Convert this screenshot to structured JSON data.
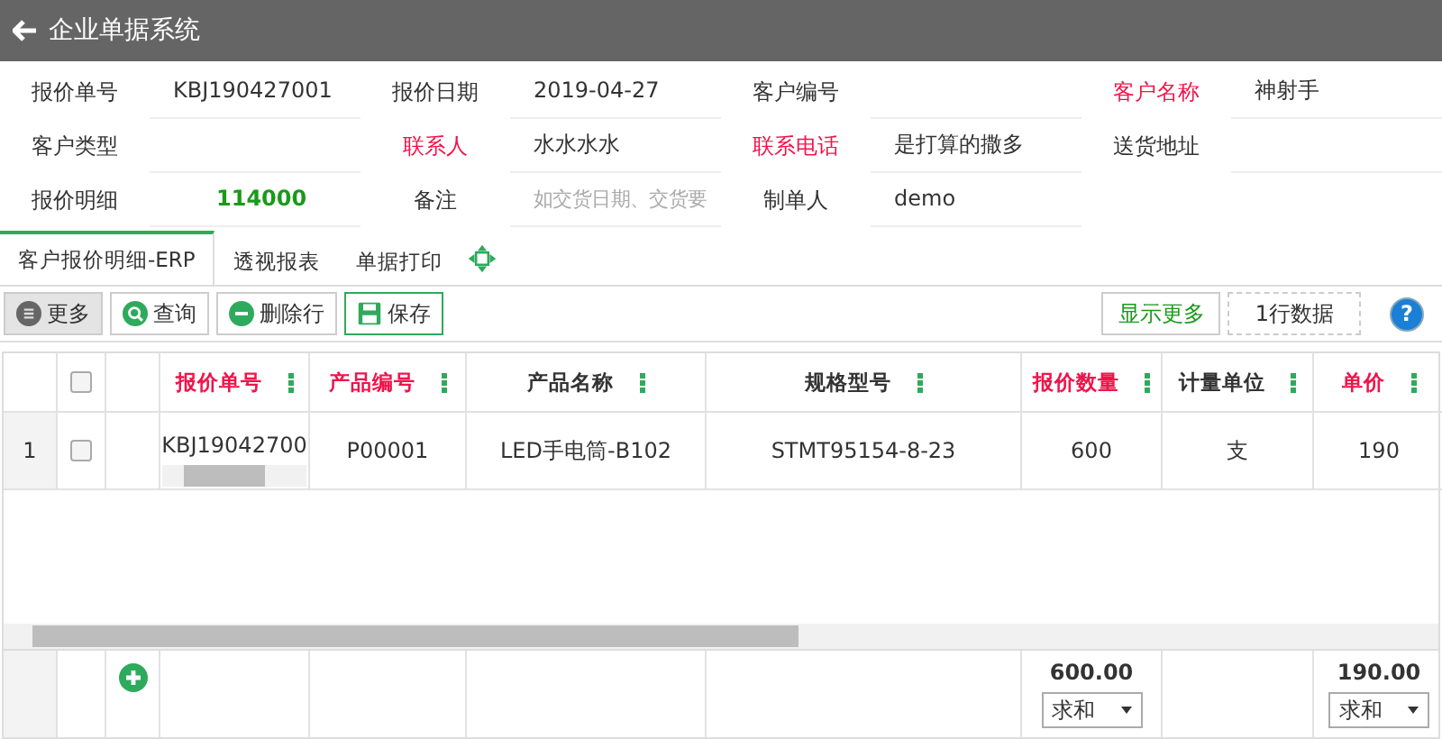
{
  "window": {
    "title": "企业单据系统"
  },
  "form": [
    {
      "label": "报价单号",
      "required": false,
      "kind": "text",
      "value": "KBJ190427001"
    },
    {
      "label": "报价日期",
      "required": false,
      "kind": "text",
      "value": "2019-04-27"
    },
    {
      "label": "客户编号",
      "required": false,
      "kind": "text"
    },
    {
      "label": "客户名称",
      "required": true,
      "kind": "text",
      "value": "神射手"
    },
    {
      "label": "客户类型",
      "required": false,
      "kind": "text"
    },
    {
      "label": "联系人",
      "required": true,
      "kind": "text",
      "value": "水水水水"
    },
    {
      "label": "联系电话",
      "required": true,
      "kind": "text",
      "value": "是打算的撒多"
    },
    {
      "label": "送货地址",
      "required": false,
      "kind": "text"
    },
    {
      "label": "报价明细",
      "required": false,
      "kind": "amount",
      "value": "114000"
    },
    {
      "label": "备注",
      "required": false,
      "kind": "text",
      "placeholder": "如交货日期、交货要"
    },
    {
      "label": "制单人",
      "required": false,
      "kind": "text",
      "value": "demo"
    }
  ],
  "tabs": [
    {
      "label": "客户报价明细-ERP",
      "selected": true
    },
    {
      "label": "透视报表",
      "selected": false
    },
    {
      "label": "单据打印",
      "selected": false
    }
  ],
  "toolbar": [
    {
      "label": "更多",
      "kind": "more"
    },
    {
      "label": "查询",
      "kind": "search"
    },
    {
      "label": "删除行",
      "kind": "delete"
    },
    {
      "label": "保存",
      "kind": "save"
    }
  ],
  "toolbar_right": {
    "show_more": "显示更多",
    "row_count": "1行数据",
    "help": "?"
  },
  "table": {
    "columns": [
      {
        "label": "报价单号",
        "required": true
      },
      {
        "label": "产品编号",
        "required": true
      },
      {
        "label": "产品名称",
        "required": false
      },
      {
        "label": "规格型号",
        "required": false
      },
      {
        "label": "报价数量",
        "required": true,
        "total": {
          "value": "600.00",
          "aggregate": "求和"
        }
      },
      {
        "label": "计量单位",
        "required": false
      },
      {
        "label": "单价",
        "required": true,
        "total": {
          "value": "190.00",
          "aggregate": "求和"
        }
      }
    ],
    "rows": [
      {
        "number": "1",
        "checked": false,
        "cells": [
          "KBJ19042700",
          "P00001",
          "LED手电筒-B102",
          "STMT95154-8-23",
          "600",
          "支",
          "190"
        ]
      }
    ],
    "header_checked": false
  }
}
